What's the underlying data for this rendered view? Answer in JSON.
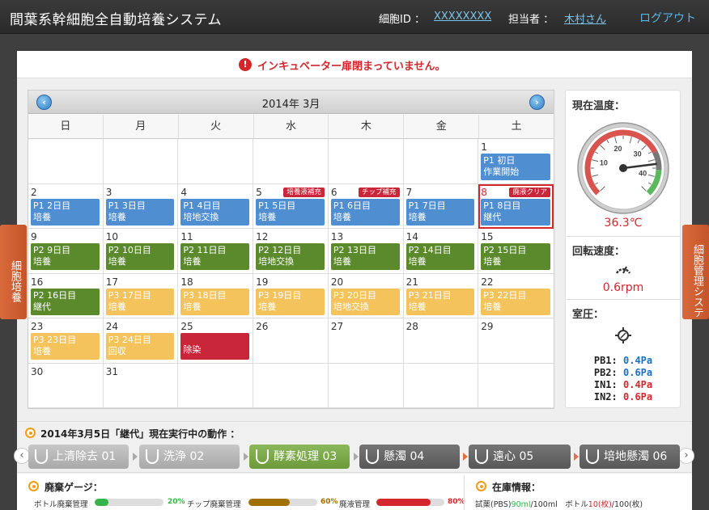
{
  "header": {
    "title": "間葉系幹細胞全自動培養システム",
    "cell_id_label": "細胞ID ：",
    "cell_id_value": "XXXXXXXX",
    "owner_label": "担当者 ：",
    "owner_value": "木村さん",
    "logout": "ログアウト"
  },
  "alert": {
    "text": "インキュベーター扉閉まっていません。"
  },
  "side_tabs": {
    "left": "細胞培養",
    "right": "細胞管理システム"
  },
  "calendar": {
    "month": "2014年 3月",
    "weekdays": [
      "日",
      "月",
      "火",
      "水",
      "木",
      "金",
      "土"
    ],
    "cells": [
      {
        "day": "",
        "line1": "",
        "line2": "",
        "color": "",
        "badge": ""
      },
      {
        "day": "",
        "line1": "",
        "line2": "",
        "color": "",
        "badge": ""
      },
      {
        "day": "",
        "line1": "",
        "line2": "",
        "color": "",
        "badge": ""
      },
      {
        "day": "",
        "line1": "",
        "line2": "",
        "color": "",
        "badge": ""
      },
      {
        "day": "",
        "line1": "",
        "line2": "",
        "color": "",
        "badge": ""
      },
      {
        "day": "",
        "line1": "",
        "line2": "",
        "color": "",
        "badge": ""
      },
      {
        "day": "1",
        "line1": "P1 初日",
        "line2": "作業開始",
        "color": "blue",
        "badge": ""
      },
      {
        "day": "2",
        "line1": "P1 2日目",
        "line2": "培養",
        "color": "blue",
        "badge": ""
      },
      {
        "day": "3",
        "line1": "P1 3日目",
        "line2": "培養",
        "color": "blue",
        "badge": ""
      },
      {
        "day": "4",
        "line1": "P1 4日目",
        "line2": "培地交換",
        "color": "blue",
        "badge": ""
      },
      {
        "day": "5",
        "line1": "P1 5日目",
        "line2": "培養",
        "color": "blue",
        "badge": "培養液補充"
      },
      {
        "day": "6",
        "line1": "P1 6日目",
        "line2": "培養",
        "color": "blue",
        "badge": "チップ補充"
      },
      {
        "day": "7",
        "line1": "P1 7日目",
        "line2": "培養",
        "color": "blue",
        "badge": ""
      },
      {
        "day": "8",
        "line1": "P1 8日目",
        "line2": "継代",
        "color": "blue",
        "badge": "廃液クリア",
        "selected": true
      },
      {
        "day": "9",
        "line1": "P2 9日目",
        "line2": "培養",
        "color": "green",
        "badge": ""
      },
      {
        "day": "10",
        "line1": "P2 10日目",
        "line2": "培養",
        "color": "green",
        "badge": ""
      },
      {
        "day": "11",
        "line1": "P2 11日目",
        "line2": "培養",
        "color": "green",
        "badge": ""
      },
      {
        "day": "12",
        "line1": "P2 12日目",
        "line2": "培地交換",
        "color": "green",
        "badge": ""
      },
      {
        "day": "13",
        "line1": "P2 13日目",
        "line2": "培養",
        "color": "green",
        "badge": ""
      },
      {
        "day": "14",
        "line1": "P2 14日目",
        "line2": "培養",
        "color": "green",
        "badge": ""
      },
      {
        "day": "15",
        "line1": "P2 15日目",
        "line2": "培養",
        "color": "green",
        "badge": ""
      },
      {
        "day": "16",
        "line1": "P2 16日目",
        "line2": "継代",
        "color": "green",
        "badge": ""
      },
      {
        "day": "17",
        "line1": "P3 17日目",
        "line2": "培養",
        "color": "yellow",
        "badge": ""
      },
      {
        "day": "18",
        "line1": "P3 18日目",
        "line2": "培養",
        "color": "yellow",
        "badge": ""
      },
      {
        "day": "19",
        "line1": "P3 19日目",
        "line2": "培養",
        "color": "yellow",
        "badge": ""
      },
      {
        "day": "20",
        "line1": "P3 20日目",
        "line2": "培地交換",
        "color": "yellow",
        "badge": ""
      },
      {
        "day": "21",
        "line1": "P3 21日目",
        "line2": "培養",
        "color": "yellow",
        "badge": ""
      },
      {
        "day": "22",
        "line1": "P3 22日目",
        "line2": "培養",
        "color": "yellow",
        "badge": ""
      },
      {
        "day": "23",
        "line1": "P3 23日目",
        "line2": "培養",
        "color": "yellow",
        "badge": ""
      },
      {
        "day": "24",
        "line1": "P3 24日目",
        "line2": "回収",
        "color": "yellow",
        "badge": ""
      },
      {
        "day": "25",
        "line1": "",
        "line2": "除染",
        "color": "red",
        "badge": ""
      },
      {
        "day": "26",
        "line1": "",
        "line2": "",
        "color": "",
        "badge": ""
      },
      {
        "day": "27",
        "line1": "",
        "line2": "",
        "color": "",
        "badge": ""
      },
      {
        "day": "28",
        "line1": "",
        "line2": "",
        "color": "",
        "badge": ""
      },
      {
        "day": "29",
        "line1": "",
        "line2": "",
        "color": "",
        "badge": ""
      },
      {
        "day": "30",
        "line1": "",
        "line2": "",
        "color": "",
        "badge": ""
      },
      {
        "day": "31",
        "line1": "",
        "line2": "",
        "color": "",
        "badge": ""
      },
      {
        "day": "",
        "line1": "",
        "line2": "",
        "color": "",
        "badge": ""
      },
      {
        "day": "",
        "line1": "",
        "line2": "",
        "color": "",
        "badge": ""
      },
      {
        "day": "",
        "line1": "",
        "line2": "",
        "color": "",
        "badge": ""
      },
      {
        "day": "",
        "line1": "",
        "line2": "",
        "color": "",
        "badge": ""
      },
      {
        "day": "",
        "line1": "",
        "line2": "",
        "color": "",
        "badge": ""
      }
    ]
  },
  "status": {
    "temp_label": "現在温度：",
    "temp_value": "36.3℃",
    "temp_reading": 36.3,
    "gauge_ticks": [
      "10",
      "20",
      "30",
      "40"
    ],
    "rot_label": "回転速度：",
    "rot_value": "0.6rpm",
    "pressure_label": "室圧：",
    "pressures": [
      {
        "name": "PB1:",
        "value": "0.4Pa",
        "color": "#1a6fc0"
      },
      {
        "name": "PB2:",
        "value": "0.6Pa",
        "color": "#1a6fc0"
      },
      {
        "name": "IN1:",
        "value": "0.4Pa",
        "color": "#d4262d"
      },
      {
        "name": "IN2:",
        "value": "0.6Pa",
        "color": "#d4262d"
      }
    ]
  },
  "action": {
    "title": "2014年3月5日「継代」現在実行中の動作 ：",
    "steps": [
      {
        "label": "上清除去 01",
        "state": "done"
      },
      {
        "label": "洗浄 02",
        "state": "done"
      },
      {
        "label": "酵素処理 03",
        "state": "active"
      },
      {
        "label": "懸濁 04",
        "state": "todo"
      },
      {
        "label": "遠心 05",
        "state": "todo"
      },
      {
        "label": "培地懸濁 06",
        "state": "todo"
      }
    ]
  },
  "waste": {
    "title": "廃棄ゲージ：",
    "items": [
      {
        "label": "ボトル廃棄管理",
        "pct_text": "20%",
        "pct": 20,
        "color": "#33b54a"
      },
      {
        "label": "チップ廃棄管理",
        "pct_text": "60%",
        "pct": 60,
        "color": "#a07000"
      },
      {
        "label": "廃液管理",
        "pct_text": "80%",
        "pct": 80,
        "color": "#d4262d"
      }
    ]
  },
  "stock": {
    "title": "在庫情報：",
    "reagent_label": "試薬(PBS)",
    "reagent_value": "90ml",
    "reagent_total": "/100ml",
    "bottle_label": "ボトル",
    "bottle_value": "10(枚)",
    "bottle_total": "/100(枚)"
  }
}
